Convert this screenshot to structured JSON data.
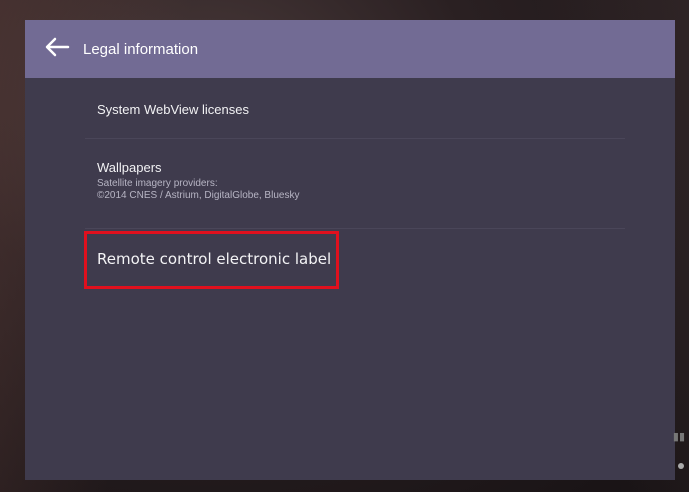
{
  "appbar": {
    "title": "Legal information",
    "back_icon": "arrow-left-icon"
  },
  "items": [
    {
      "title": "System WebView licenses"
    },
    {
      "title": "Wallpapers",
      "subtitle_line1": "Satellite imagery providers:",
      "subtitle_line2": "©2014 CNES / Astrium, DigitalGlobe, Bluesky"
    },
    {
      "title": "Remote control electronic label",
      "highlighted": true
    }
  ],
  "colors": {
    "appbar": "#726b94",
    "panel": "#3f3b4d",
    "highlight": "#e0101e"
  }
}
